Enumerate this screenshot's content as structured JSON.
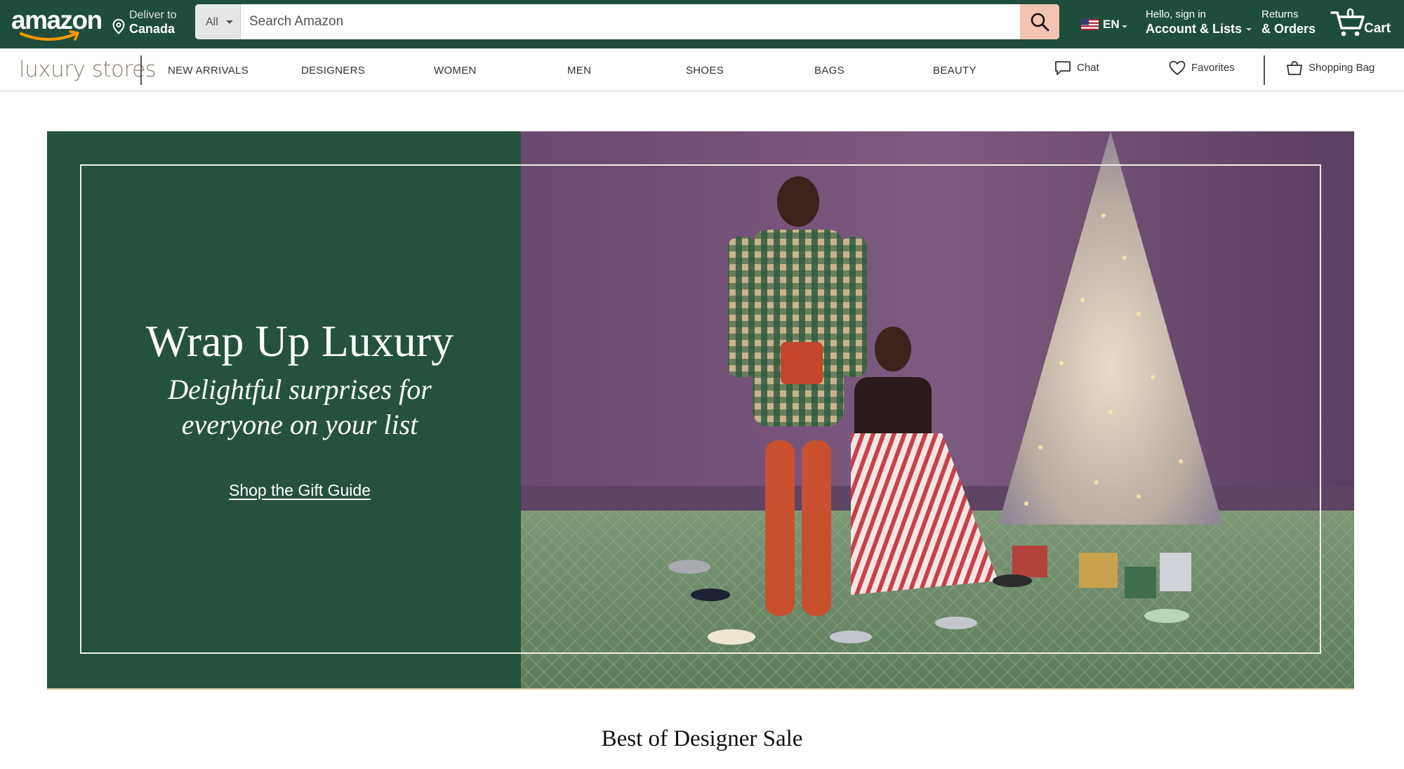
{
  "header": {
    "logo": "amazon",
    "deliver": {
      "line1": "Deliver to",
      "line2": "Canada"
    },
    "search": {
      "category": "All",
      "placeholder": "Search Amazon"
    },
    "language": "EN",
    "account": {
      "line1": "Hello, sign in",
      "line2": "Account & Lists"
    },
    "returns": {
      "line1": "Returns",
      "line2": "& Orders"
    },
    "cart": {
      "count": "0",
      "label": "Cart"
    },
    "colors": {
      "nav_bg": "#1f4d3c",
      "search_button": "#f3c3b3"
    }
  },
  "luxury_nav": {
    "logo": "luxury stores",
    "items": [
      "NEW ARRIVALS",
      "DESIGNERS",
      "WOMEN",
      "MEN",
      "SHOES",
      "BAGS",
      "BEAUTY"
    ],
    "chat": "Chat",
    "favorites": "Favorites",
    "shopping_bag": "Shopping Bag"
  },
  "hero": {
    "title": "Wrap Up Luxury",
    "subtitle": "Delightful surprises for everyone on your list",
    "cta": "Shop the Gift Guide",
    "colors": {
      "panel": "#24523f",
      "wall": "#6e4f72",
      "floor": "#6f8c6b"
    }
  },
  "section": {
    "title": "Best of Designer Sale"
  }
}
